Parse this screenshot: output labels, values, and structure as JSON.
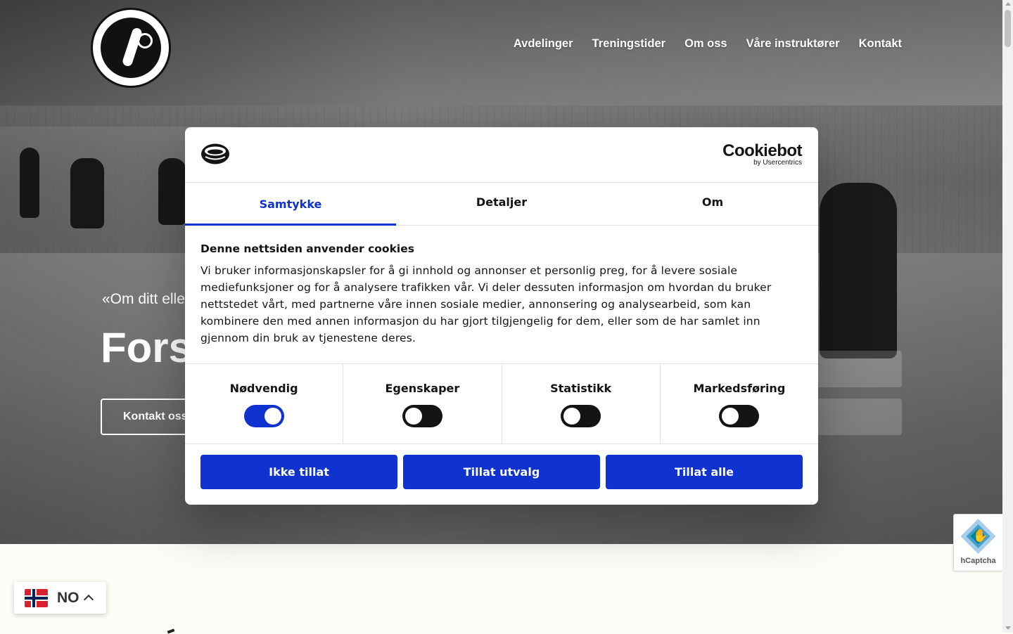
{
  "site": {
    "nav": [
      "Avdelinger",
      "Treningstider",
      "Om oss",
      "Våre instruktører",
      "Kontakt"
    ],
    "hero": {
      "quote": "«Om ditt eller",
      "headline": "Forsvar",
      "contact_button": "Kontakt oss"
    }
  },
  "cookie_dialog": {
    "brand": "Cookiebot",
    "brand_sub": "by Usercentrics",
    "tabs": [
      "Samtykke",
      "Detaljer",
      "Om"
    ],
    "active_tab": "Samtykke",
    "heading": "Denne nettsiden anvender cookies",
    "text": "Vi bruker informasjonskapsler for å gi innhold og annonser et personlig preg, for å levere sosiale mediefunksjoner og for å analysere trafikken vår. Vi deler dessuten informasjon om hvordan du bruker nettstedet vårt, med partnerne våre innen sosiale medier, annonsering og analysearbeid, som kan kombinere den med annen informasjon du har gjort tilgjengelig for dem, eller som de har samlet inn gjennom din bruk av tjenestene deres.",
    "categories": [
      {
        "label": "Nødvendig",
        "enabled": true
      },
      {
        "label": "Egenskaper",
        "enabled": false
      },
      {
        "label": "Statistikk",
        "enabled": false
      },
      {
        "label": "Markedsføring",
        "enabled": false
      }
    ],
    "buttons": [
      "Ikke tillat",
      "Tillat utvalg",
      "Tillat alle"
    ],
    "accent_color": "#1032cf"
  },
  "language_switcher": {
    "code": "NO",
    "flag": "norway-flag-icon"
  },
  "hcaptcha": {
    "label": "hCaptcha"
  }
}
